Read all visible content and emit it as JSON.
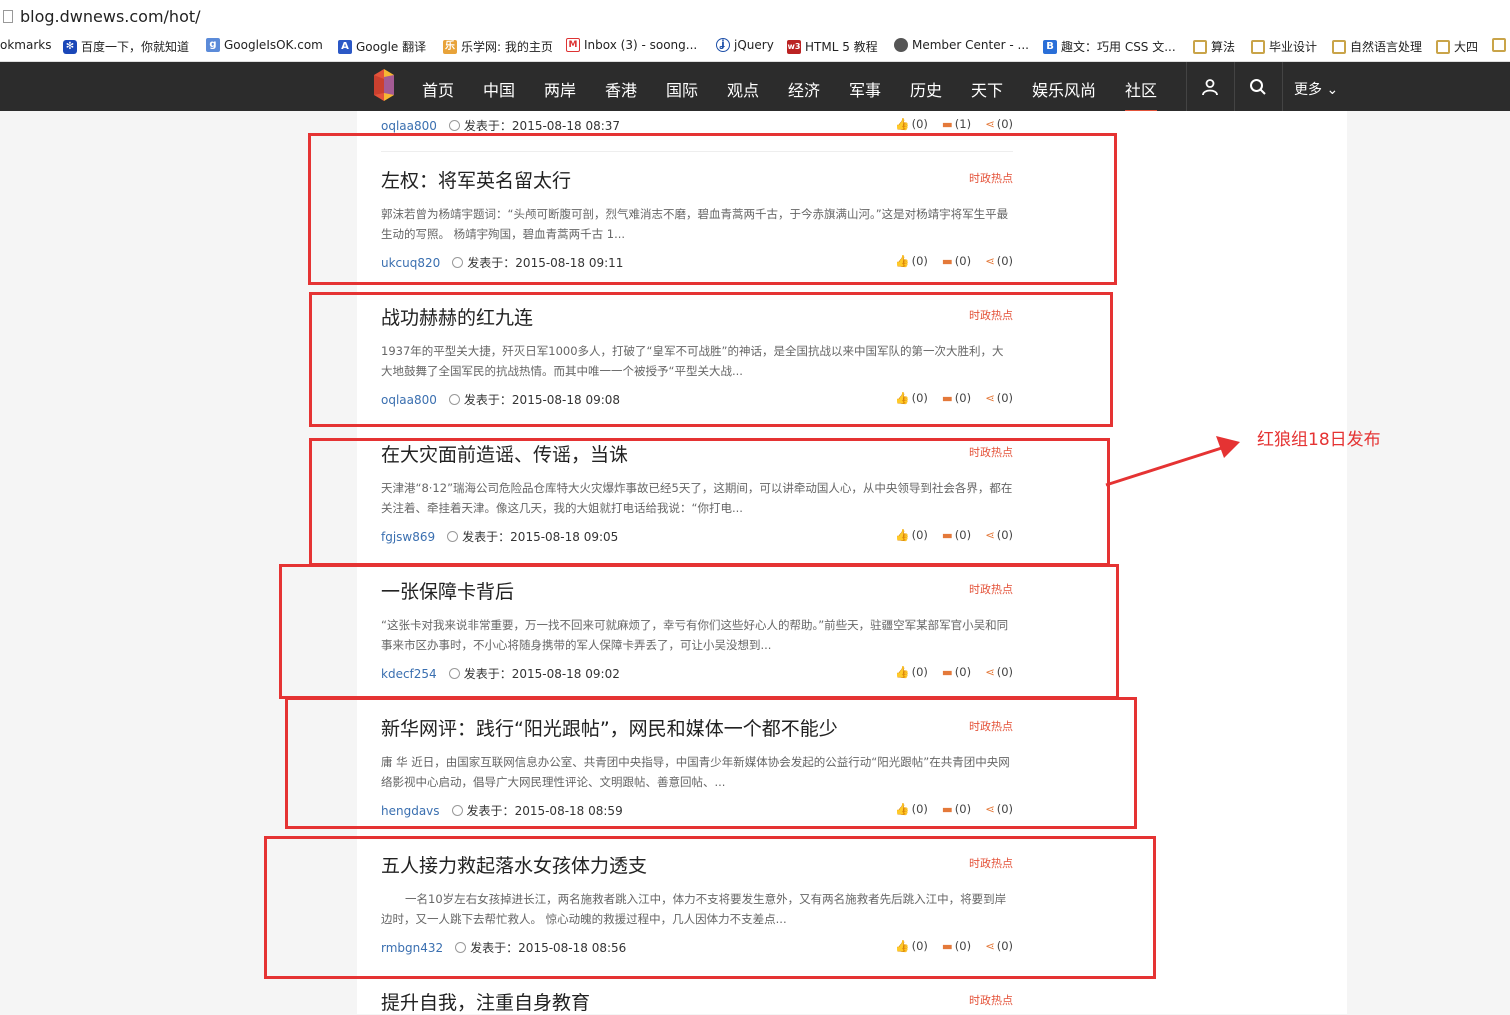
{
  "browser": {
    "url": "blog.dwnews.com/hot/",
    "bookmarks": [
      "okmarks",
      "百度一下，你就知道",
      "GoogleIsOK.com",
      "Google 翻译",
      "乐学网: 我的主页",
      "Inbox (3) - soong...",
      "jQuery",
      "HTML 5 教程",
      "Member Center - ...",
      "趣文：巧用 CSS 文...",
      "算法",
      "毕业设计",
      "自然语言处理",
      "大四"
    ]
  },
  "nav": {
    "items": [
      "首页",
      "中国",
      "两岸",
      "香港",
      "国际",
      "观点",
      "经济",
      "军事",
      "历史",
      "天下",
      "娱乐风尚",
      "社区"
    ],
    "active": "社区",
    "more": "更多"
  },
  "posted_label": "发表于：",
  "posts": [
    {
      "title": "",
      "category": "",
      "excerpt": "",
      "author": "oqlaa800",
      "time": "2015-08-18 08:37",
      "likes": "(0)",
      "comments": "(1)",
      "shares": "(0)"
    },
    {
      "title": "左权：将军英名留太行",
      "category": "时政热点",
      "excerpt": "郭沫若曾为杨靖宇题词：“头颅可断腹可剖，烈气难消志不磨，碧血青蒿两千古，于今赤旗满山河。”这是对杨靖宇将军生平最生动的写照。 杨靖宇殉国，碧血青蒿两千古 1...",
      "author": "ukcuq820",
      "time": "2015-08-18 09:11",
      "likes": "(0)",
      "comments": "(0)",
      "shares": "(0)"
    },
    {
      "title": "战功赫赫的红九连",
      "category": "时政热点",
      "excerpt": "1937年的平型关大捷，歼灭日军1000多人，打破了“皇军不可战胜”的神话，是全国抗战以来中国军队的第一次大胜利，大大地鼓舞了全国军民的抗战热情。而其中唯一一个被授予“平型关大战...",
      "author": "oqlaa800",
      "time": "2015-08-18 09:08",
      "likes": "(0)",
      "comments": "(0)",
      "shares": "(0)"
    },
    {
      "title": "在大灾面前造谣、传谣，当诛",
      "category": "时政热点",
      "excerpt": "天津港“8·12”瑞海公司危险品仓库特大火灾爆炸事故已经5天了，这期间，可以讲牵动国人心，从中央领导到社会各界，都在关注着、牵挂着天津。像这几天，我的大姐就打电话给我说：“你打电...",
      "author": "fgjsw869",
      "time": "2015-08-18 09:05",
      "likes": "(0)",
      "comments": "(0)",
      "shares": "(0)"
    },
    {
      "title": "一张保障卡背后",
      "category": "时政热点",
      "excerpt": "“这张卡对我来说非常重要，万一找不回来可就麻烦了，幸亏有你们这些好心人的帮助。”前些天，驻疆空军某部军官小吴和同事来市区办事时，不小心将随身携带的军人保障卡弄丢了，可让小吴没想到...",
      "author": "kdecf254",
      "time": "2015-08-18 09:02",
      "likes": "(0)",
      "comments": "(0)",
      "shares": "(0)"
    },
    {
      "title": "新华网评：践行“阳光跟帖”，网民和媒体一个都不能少",
      "category": "时政热点",
      "excerpt": "庸 华 近日，由国家互联网信息办公室、共青团中央指导，中国青少年新媒体协会发起的公益行动“阳光跟帖”在共青团中央网络影视中心启动，倡导广大网民理性评论、文明跟帖、善意回帖、...",
      "author": "hengdavs",
      "time": "2015-08-18 08:59",
      "likes": "(0)",
      "comments": "(0)",
      "shares": "(0)"
    },
    {
      "title": "五人接力救起落水女孩体力透支",
      "category": "时政热点",
      "excerpt": "一名10岁左右女孩掉进长江，两名施救者跳入江中，体力不支将要发生意外，又有两名施救者先后跳入江中，将要到岸边时，又一人跳下去帮忙救人。 惊心动魄的救援过程中，几人因体力不支差点...",
      "author": "rmbgn432",
      "time": "2015-08-18 08:56",
      "likes": "(0)",
      "comments": "(0)",
      "shares": "(0)"
    },
    {
      "title": "提升自我，注重自身教育",
      "category": "时政热点",
      "excerpt": "",
      "author": "",
      "time": "",
      "likes": "",
      "comments": "",
      "shares": ""
    }
  ],
  "annotation": {
    "text": "红狼组18日发布",
    "color": "#e53333"
  },
  "colors": {
    "accent": "#e4533a",
    "nav_bg": "#2c2c2c",
    "author_link": "#3a6fb0"
  }
}
